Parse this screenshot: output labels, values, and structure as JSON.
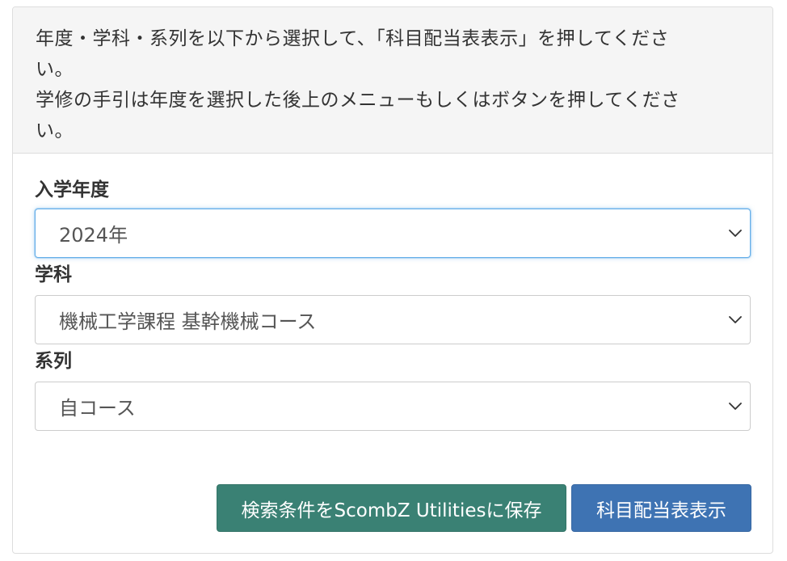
{
  "heading": {
    "line1": "年度・学科・系列を以下から選択して、「科目配当表表示」を押してくださ",
    "line2": "い。",
    "line3": "学修の手引は年度を選択した後上のメニューもしくはボタンを押してくださ",
    "line4": "い。"
  },
  "form": {
    "year": {
      "label": "入学年度",
      "selected": "2024年"
    },
    "department": {
      "label": "学科",
      "selected": "機械工学課程 基幹機械コース"
    },
    "series": {
      "label": "系列",
      "selected": "自コース"
    }
  },
  "buttons": {
    "save_label": "検索条件をScombZ Utilitiesに保存",
    "show_label": "科目配当表表示"
  },
  "colors": {
    "save_button": "#3a8174",
    "show_button": "#3e73b3",
    "focus_border": "#66afe9"
  },
  "icons": {
    "select_arrow": "chevron-down-icon"
  }
}
